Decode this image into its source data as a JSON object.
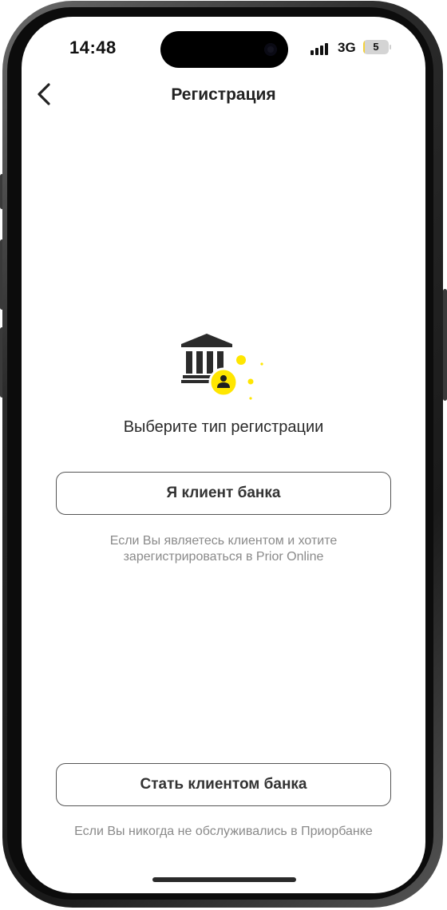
{
  "status_bar": {
    "time": "14:48",
    "network": "3G",
    "battery": "5",
    "battery_level": 0.05
  },
  "nav": {
    "back_icon": "chevron-left-icon",
    "title": "Регистрация"
  },
  "illustration": {
    "icon": "bank-user-icon",
    "accent_color": "#ffe600"
  },
  "main": {
    "prompt": "Выберите тип регистрации",
    "client_button_label": "Я клиент банка",
    "client_hint": "Если Вы являетесь клиентом и хотите зарегистрироваться в Prior Online",
    "become_button_label": "Стать клиентом банка",
    "become_hint": "Если Вы никогда не обслуживались в Приорбанке"
  }
}
